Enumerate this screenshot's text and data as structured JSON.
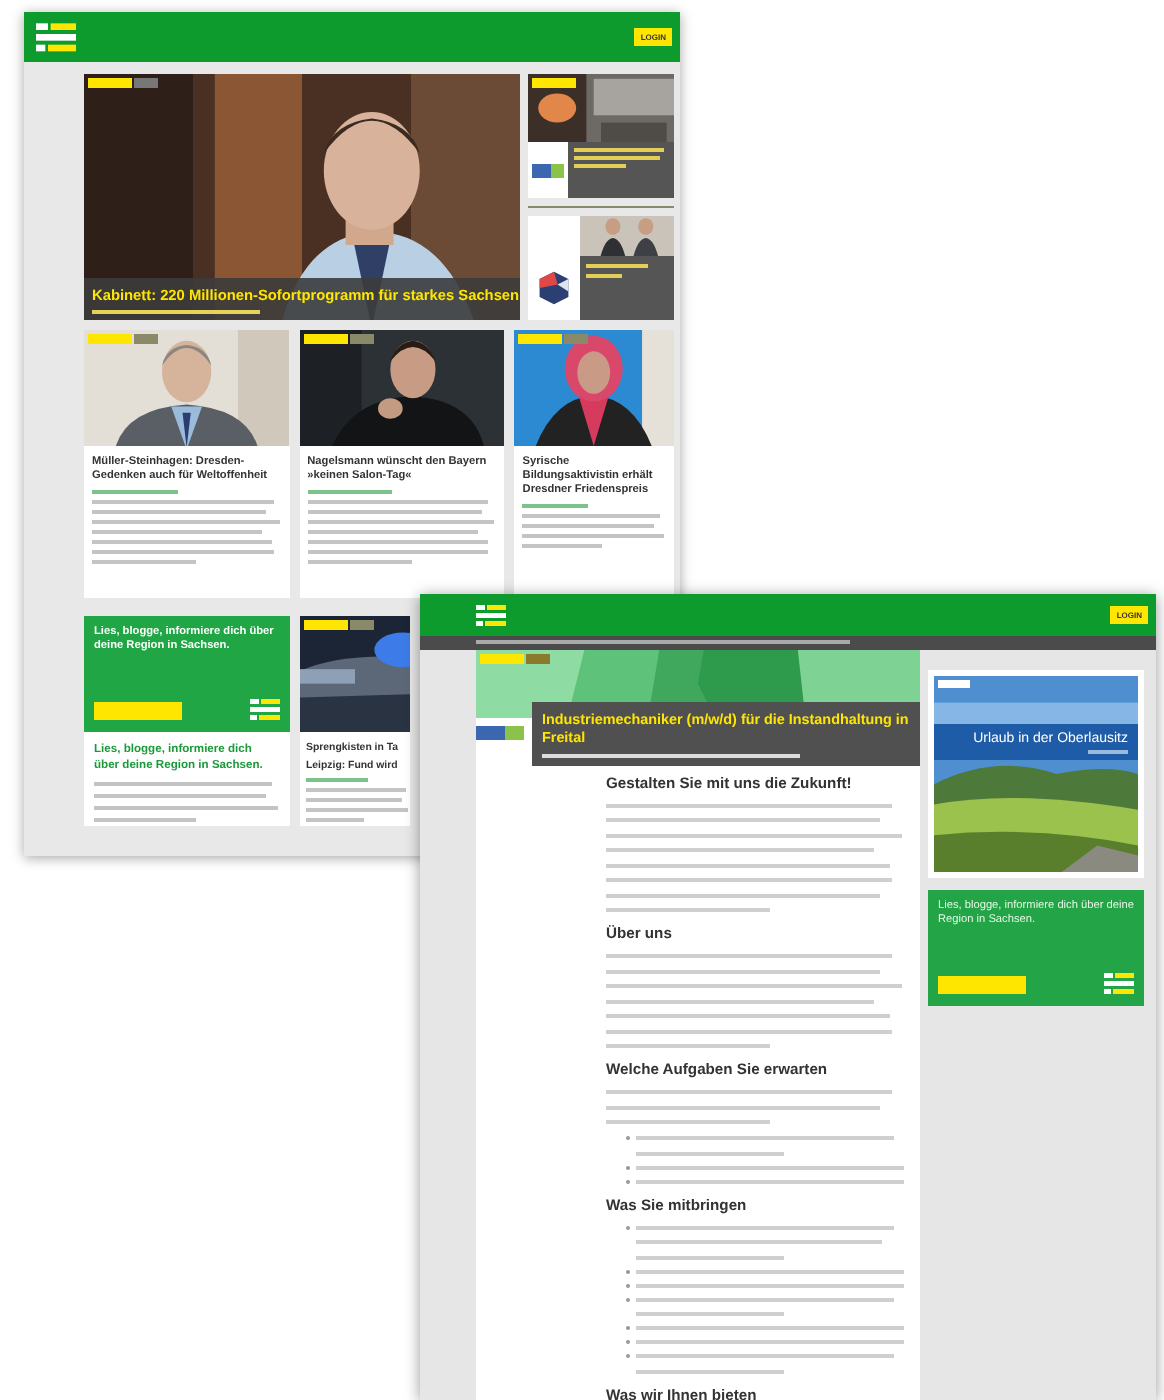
{
  "back_page": {
    "header": {
      "login": "LOGIN"
    },
    "hero": {
      "title": "Kabinett: 220 Millionen-Sofortprogramm für starkes Sachsen"
    },
    "cards": [
      {
        "title": "Müller-Steinhagen: Dresden-Gedenken auch für Weltoffenheit",
        "kind": "man-suit"
      },
      {
        "title": "Nagelsmann wünscht den Bayern »keinen Salon-Tag«",
        "kind": "man-dark"
      },
      {
        "title": "Syrische Bildungsaktivistin erhält Dresdner Friedenspreis",
        "kind": "woman"
      }
    ],
    "promo": {
      "text": "Lies, blogge, informiere dich über deine Region in Sachsen."
    },
    "promo_heading": "Lies, blogge, informiere dich über deine Region in Sachsen.",
    "partial_card": {
      "title_lines": [
        "Sprengkisten in Ta",
        "Leipzig: Fund wird"
      ]
    }
  },
  "front_page": {
    "header": {
      "login": "LOGIN"
    },
    "job": {
      "title": "Industriemechaniker (m/w/d) für die Instandhaltung in Freital"
    },
    "sections": [
      {
        "heading": "Gestalten Sie mit uns die Zukunft!",
        "kind": "paragraph"
      },
      {
        "heading": "Über uns",
        "kind": "paragraph"
      },
      {
        "heading": "Welche Aufgaben Sie erwarten",
        "kind": "list"
      },
      {
        "heading": "Was Sie mitbringen",
        "kind": "list"
      },
      {
        "heading": "Was wir Ihnen bieten",
        "kind": "end"
      }
    ],
    "ad": {
      "title": "Urlaub in der Oberlausitz"
    },
    "promo": {
      "text": "Lies, blogge, informiere dich über deine Region in Sachsen."
    }
  }
}
